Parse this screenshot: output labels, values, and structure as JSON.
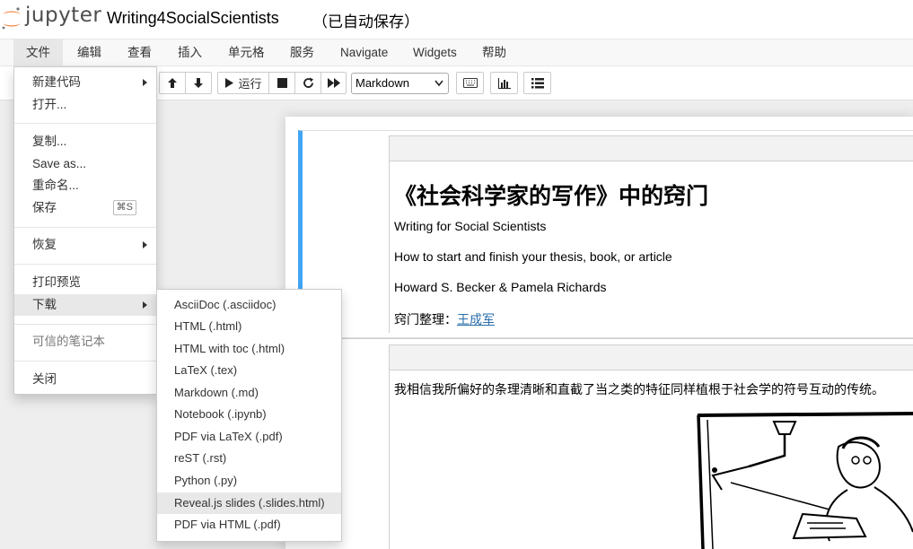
{
  "header": {
    "logo_text": "jupyter",
    "notebook_title": "Writing4SocialScientists",
    "autosave_status": "（已自动保存）"
  },
  "menubar": {
    "items": [
      {
        "label": "文件"
      },
      {
        "label": "编辑"
      },
      {
        "label": "查看"
      },
      {
        "label": "插入"
      },
      {
        "label": "单元格"
      },
      {
        "label": "服务"
      },
      {
        "label": "Navigate"
      },
      {
        "label": "Widgets"
      },
      {
        "label": "帮助"
      }
    ]
  },
  "toolbar": {
    "run_label": "运行",
    "cell_type": "Markdown"
  },
  "file_menu": {
    "new_notebook": "新建代码",
    "open": "打开...",
    "copy": "复制...",
    "save_as": "Save as...",
    "rename": "重命名...",
    "save": "保存",
    "save_shortcut": "⌘S",
    "revert": "恢复",
    "print_preview": "打印预览",
    "download": "下载",
    "trusted": "可信的笔记本",
    "close": "关闭"
  },
  "download_menu": {
    "items": [
      {
        "label": "AsciiDoc (.asciidoc)"
      },
      {
        "label": "HTML (.html)"
      },
      {
        "label": "HTML with toc (.html)"
      },
      {
        "label": "LaTeX (.tex)"
      },
      {
        "label": "Markdown (.md)"
      },
      {
        "label": "Notebook (.ipynb)"
      },
      {
        "label": "PDF via LaTeX (.pdf)"
      },
      {
        "label": "reST (.rst)"
      },
      {
        "label": "Python (.py)"
      },
      {
        "label": "Reveal.js slides (.slides.html)"
      },
      {
        "label": "PDF via HTML (.pdf)"
      }
    ],
    "highlighted_item": "Reveal.js slides (.slides.html)"
  },
  "notebook": {
    "cell1": {
      "heading": "《社会科学家的写作》中的窍门",
      "line1": "Writing for Social Scientists",
      "line2": "How to start and finish your thesis, book, or article",
      "line3": "Howard S. Becker & Pamela Richards",
      "credit_prefix": "窍门整理：",
      "credit_link": "王成军"
    },
    "cell2": {
      "text": "我相信我所偏好的条理清晰和直截了当之类的特征同样植根于社会学的符号互动的传统。"
    }
  },
  "colors": {
    "selected_cell_border": "#42a5f5",
    "link": "#296eaa",
    "logo_orange": "#f37726"
  }
}
